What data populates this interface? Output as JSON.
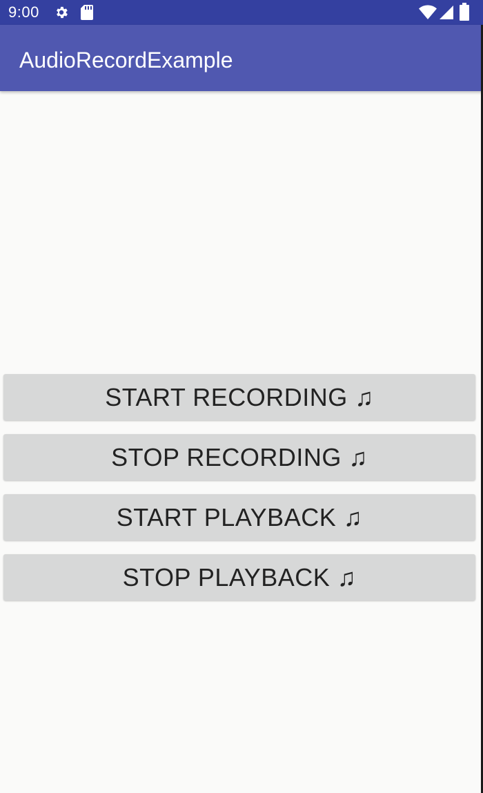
{
  "status_bar": {
    "time": "9:00",
    "icons": [
      "gear-icon",
      "sd-card-icon",
      "wifi-icon",
      "signal-icon",
      "battery-icon"
    ]
  },
  "app_bar": {
    "title": "AudioRecordExample"
  },
  "buttons": {
    "start_recording": "START RECORDING ♫",
    "stop_recording": "STOP RECORDING ♫",
    "start_playback": "START PLAYBACK ♫",
    "stop_playback": "STOP PLAYBACK ♫"
  },
  "colors": {
    "status_bar": "#3440a0",
    "app_bar": "#5058b0",
    "button_bg": "#d7d8d8",
    "background": "#fafaf9"
  }
}
